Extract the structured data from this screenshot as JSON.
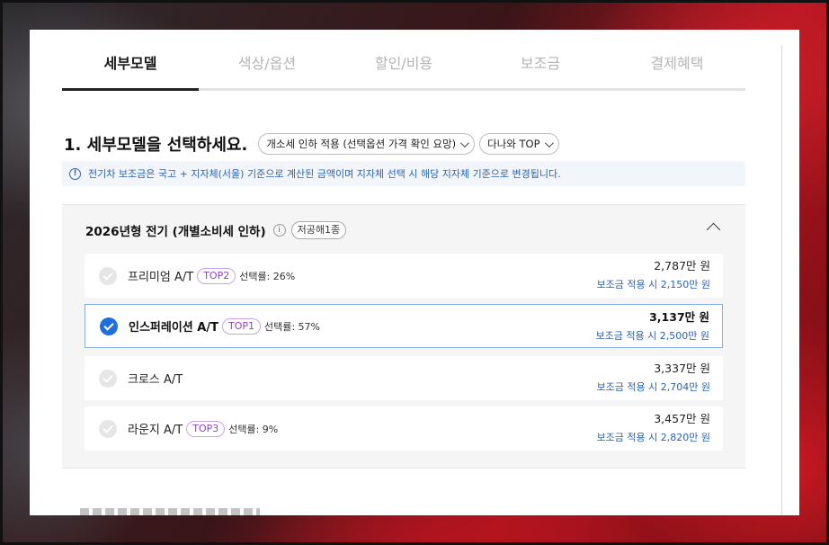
{
  "tabs": [
    {
      "label": "세부모델",
      "active": true
    },
    {
      "label": "색상/옵션",
      "active": false
    },
    {
      "label": "할인/비용",
      "active": false
    },
    {
      "label": "보조금",
      "active": false
    },
    {
      "label": "결제혜택",
      "active": false
    }
  ],
  "heading": {
    "title": "1. 세부모델을 선택하세요.",
    "filter1": "개소세 인하 적용 (선택옵션 가격 확인 요망)",
    "filter2": "다나와 TOP"
  },
  "info": {
    "icon": "info-icon",
    "text": "전기차 보조금은 국고 + 지자체(서울) 기준으로 계산된 금액이며 지자체 선택 시 해당 지자체 기준으로 변경됩니다."
  },
  "group": {
    "title": "2026년형 전기 (개별소비세 인하)",
    "info_icon": "i",
    "tag": "저공해1종",
    "models": [
      {
        "name": "프리미엄 A/T",
        "badge": "TOP2",
        "rate": "선택률: 26%",
        "price": "2,787만 원",
        "subsidy": "보조금 적용 시 2,150만 원",
        "selected": false
      },
      {
        "name": "인스퍼레이션 A/T",
        "badge": "TOP1",
        "rate": "선택률: 57%",
        "price": "3,137만 원",
        "subsidy": "보조금 적용 시 2,500만 원",
        "selected": true
      },
      {
        "name": "크로스 A/T",
        "badge": "",
        "rate": "",
        "price": "3,337만 원",
        "subsidy": "보조금 적용 시 2,704만 원",
        "selected": false
      },
      {
        "name": "라운지 A/T",
        "badge": "TOP3",
        "rate": "선택률: 9%",
        "price": "3,457만 원",
        "subsidy": "보조금 적용 시 2,820만 원",
        "selected": false
      }
    ]
  },
  "colors": {
    "accent_blue": "#1f6fe0",
    "link_blue": "#2a64b0",
    "badge_purple": "#8a45c7"
  }
}
